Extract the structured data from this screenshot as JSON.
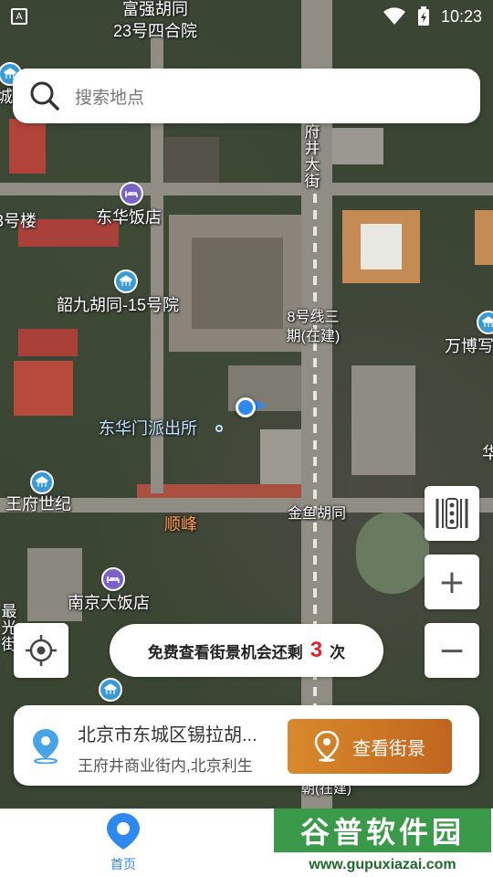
{
  "status_bar": {
    "time": "10:23"
  },
  "search": {
    "placeholder": "搜索地点"
  },
  "map": {
    "labels": {
      "top_street_1": "富强胡同",
      "top_street_2": "23号四合院",
      "left_edge_1": "城",
      "left_edge_2": "3号楼",
      "wangfujing_vertical": "府井大街",
      "dongyue": "东华饭店",
      "shaojiu": "韶九胡同-15号院",
      "line8_1": "8号线三",
      "line8_2": "期(在建)",
      "wanbo": "万博写",
      "donghuamen": "东华门派出所",
      "hua_edge": "华",
      "wangfu_shiji": "王府世纪",
      "shunfeng": "顺峰",
      "jinyu": "金鱼胡同",
      "nanjing": "南京大饭店",
      "left_vert": "最光街",
      "partial_under": "朝(在建)"
    }
  },
  "controls": {
    "plus": "+",
    "minus": "−"
  },
  "free_view": {
    "prefix": "免费查看街景机会还剩",
    "count": "3",
    "suffix": "次"
  },
  "location_card": {
    "address": "北京市东城区锡拉胡...",
    "detail": "王府井商业街内,北京利生",
    "button_label": "查看街景"
  },
  "bottom_nav": {
    "home_label": "首页"
  },
  "watermark": {
    "title": "谷普软件园",
    "url": "www.gupuxiazai.com"
  },
  "colors": {
    "accent_blue": "#2f88f0",
    "button_orange": "#d9892c",
    "count_red": "#e0212e"
  }
}
